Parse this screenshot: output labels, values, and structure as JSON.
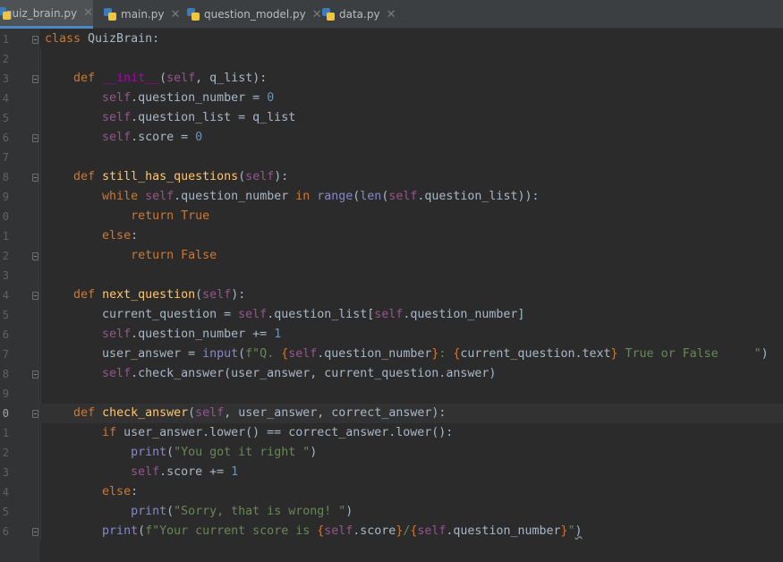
{
  "tabs": [
    {
      "label": "quiz_brain.py",
      "active": true
    },
    {
      "label": "main.py",
      "active": false
    },
    {
      "label": "question_model.py",
      "active": false
    },
    {
      "label": "data.py",
      "active": false
    }
  ],
  "line_numbers": [
    "1",
    "2",
    "3",
    "4",
    "5",
    "6",
    "7",
    "8",
    "9",
    "0",
    "1",
    "2",
    "3",
    "4",
    "5",
    "6",
    "7",
    "8",
    "9",
    "0",
    "1",
    "2",
    "3",
    "4",
    "5",
    "6"
  ],
  "code": [
    [
      [
        "class",
        "k"
      ],
      [
        " QuizBrain:",
        "t"
      ]
    ],
    [],
    [
      [
        "    ",
        "t"
      ],
      [
        "def",
        "k"
      ],
      [
        " ",
        "t"
      ],
      [
        "__init__",
        "m"
      ],
      [
        "(",
        "t"
      ],
      [
        "self",
        "s"
      ],
      [
        ", q_list):",
        "t"
      ]
    ],
    [
      [
        "        ",
        "t"
      ],
      [
        "self",
        "s"
      ],
      [
        ".question_number = ",
        "t"
      ],
      [
        "0",
        "n"
      ]
    ],
    [
      [
        "        ",
        "t"
      ],
      [
        "self",
        "s"
      ],
      [
        ".question_list = q_list",
        "t"
      ]
    ],
    [
      [
        "        ",
        "t"
      ],
      [
        "self",
        "s"
      ],
      [
        ".score = ",
        "t"
      ],
      [
        "0",
        "n"
      ]
    ],
    [],
    [
      [
        "    ",
        "t"
      ],
      [
        "def",
        "k"
      ],
      [
        " ",
        "t"
      ],
      [
        "still_has_questions",
        "f"
      ],
      [
        "(",
        "t"
      ],
      [
        "self",
        "s"
      ],
      [
        "):",
        "t"
      ]
    ],
    [
      [
        "        ",
        "t"
      ],
      [
        "while",
        "k"
      ],
      [
        " ",
        "t"
      ],
      [
        "self",
        "s"
      ],
      [
        ".question_number ",
        "t"
      ],
      [
        "in",
        "k"
      ],
      [
        " ",
        "t"
      ],
      [
        "range",
        "b"
      ],
      [
        "(",
        "t"
      ],
      [
        "len",
        "b"
      ],
      [
        "(",
        "t"
      ],
      [
        "self",
        "s"
      ],
      [
        ".question_list)):",
        "t"
      ]
    ],
    [
      [
        "            ",
        "t"
      ],
      [
        "return",
        "k"
      ],
      [
        " ",
        "t"
      ],
      [
        "True",
        "k"
      ]
    ],
    [
      [
        "        ",
        "t"
      ],
      [
        "else",
        "k"
      ],
      [
        ":",
        "t"
      ]
    ],
    [
      [
        "            ",
        "t"
      ],
      [
        "return",
        "k"
      ],
      [
        " ",
        "t"
      ],
      [
        "False",
        "k"
      ]
    ],
    [],
    [
      [
        "    ",
        "t"
      ],
      [
        "def",
        "k"
      ],
      [
        " ",
        "t"
      ],
      [
        "next_question",
        "f"
      ],
      [
        "(",
        "t"
      ],
      [
        "self",
        "s"
      ],
      [
        "):",
        "t"
      ]
    ],
    [
      [
        "        current_question = ",
        "t"
      ],
      [
        "self",
        "s"
      ],
      [
        ".question_list[",
        "t"
      ],
      [
        "self",
        "s"
      ],
      [
        ".question_number]",
        "t"
      ]
    ],
    [
      [
        "        ",
        "t"
      ],
      [
        "self",
        "s"
      ],
      [
        ".question_number += ",
        "t"
      ],
      [
        "1",
        "n"
      ]
    ],
    [
      [
        "        user_answer = ",
        "t"
      ],
      [
        "input",
        "b"
      ],
      [
        "(",
        "t"
      ],
      [
        "f\"Q. ",
        "st"
      ],
      [
        "{",
        "k"
      ],
      [
        "self",
        "s"
      ],
      [
        ".question_number",
        "t"
      ],
      [
        "}",
        "k"
      ],
      [
        ": ",
        "st"
      ],
      [
        "{",
        "k"
      ],
      [
        "current_question.text",
        "t"
      ],
      [
        "}",
        "k"
      ],
      [
        " True or False     \"",
        "st"
      ],
      [
        ")",
        "t"
      ]
    ],
    [
      [
        "        ",
        "t"
      ],
      [
        "self",
        "s"
      ],
      [
        ".check_answer(user_answer, current_question.answer)",
        "t"
      ]
    ],
    [],
    [
      [
        "    ",
        "t"
      ],
      [
        "def",
        "k"
      ],
      [
        " ",
        "t"
      ],
      [
        "check_answer",
        "f"
      ],
      [
        "(",
        "t"
      ],
      [
        "self",
        "s"
      ],
      [
        ", user_answer, correct_answer):",
        "t"
      ]
    ],
    [
      [
        "        ",
        "t"
      ],
      [
        "if",
        "k"
      ],
      [
        " user_answer.lower() == correct_answer.lower():",
        "t"
      ]
    ],
    [
      [
        "            ",
        "t"
      ],
      [
        "print",
        "b"
      ],
      [
        "(",
        "t"
      ],
      [
        "\"You got it right \"",
        "st"
      ],
      [
        ")",
        "t"
      ]
    ],
    [
      [
        "            ",
        "t"
      ],
      [
        "self",
        "s"
      ],
      [
        ".score += ",
        "t"
      ],
      [
        "1",
        "n"
      ]
    ],
    [
      [
        "        ",
        "t"
      ],
      [
        "else",
        "k"
      ],
      [
        ":",
        "t"
      ]
    ],
    [
      [
        "            ",
        "t"
      ],
      [
        "print",
        "b"
      ],
      [
        "(",
        "t"
      ],
      [
        "\"Sorry, that is wrong! \"",
        "st"
      ],
      [
        ")",
        "t"
      ]
    ],
    [
      [
        "        ",
        "t"
      ],
      [
        "print",
        "b"
      ],
      [
        "(",
        "t"
      ],
      [
        "f\"Your current score is ",
        "st"
      ],
      [
        "{",
        "k"
      ],
      [
        "self",
        "s"
      ],
      [
        ".score",
        "t"
      ],
      [
        "}",
        "k"
      ],
      [
        "/",
        "st"
      ],
      [
        "{",
        "k"
      ],
      [
        "self",
        "s"
      ],
      [
        ".question_number",
        "t"
      ],
      [
        "}",
        "k"
      ],
      [
        "\"",
        "st"
      ],
      [
        ")",
        "sq"
      ]
    ]
  ],
  "colors": {
    "keyword": "#cc7832",
    "function": "#ffc66d",
    "self": "#94558d",
    "number": "#6897bb",
    "string": "#6a8759",
    "builtin": "#8888c6",
    "magic": "#b200b2",
    "text": "#a9b7c6",
    "background": "#2b2b2b"
  },
  "icons": {
    "file_tab": "python-file-icon",
    "tab_close": "close-icon",
    "fold": "fold-marker-icon"
  }
}
